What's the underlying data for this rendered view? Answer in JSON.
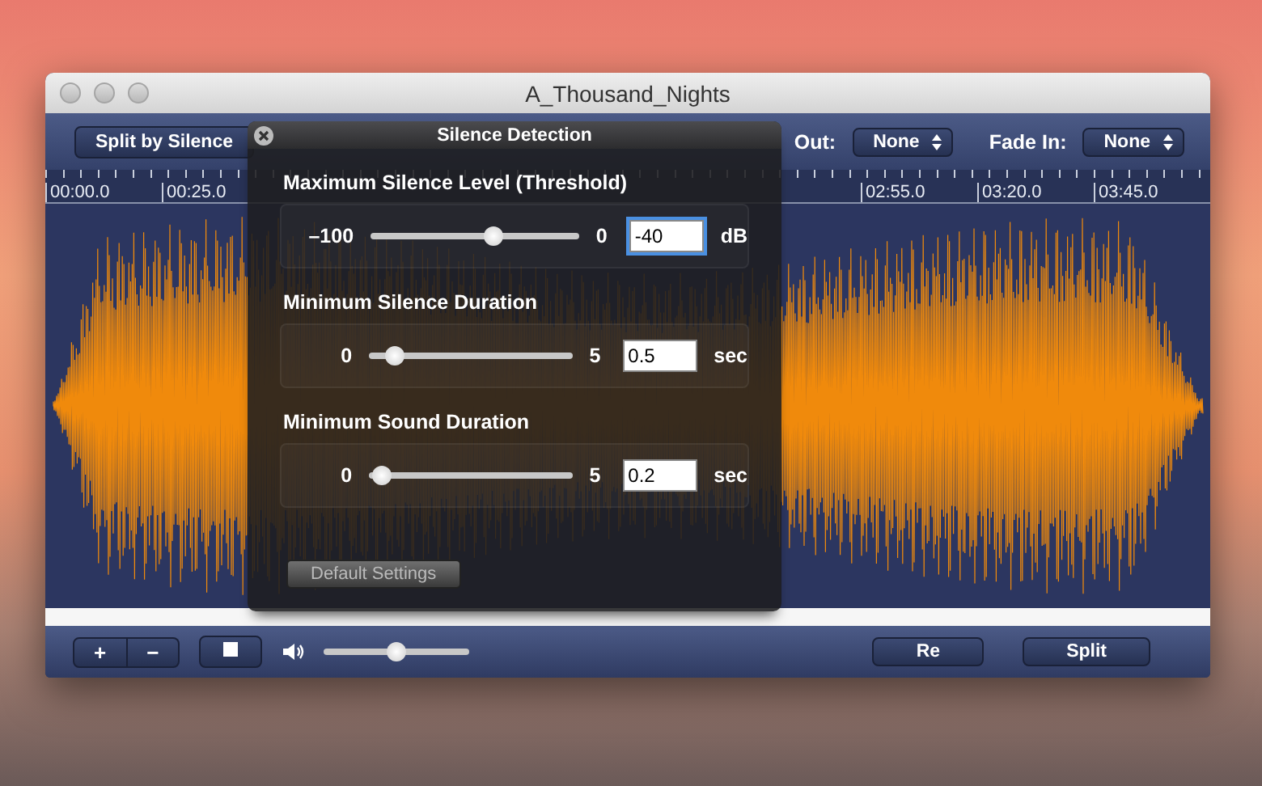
{
  "window": {
    "title": "A_Thousand_Nights"
  },
  "toolbar": {
    "split_button": "Split by Silence",
    "fade_out": {
      "label": "Out:",
      "value": "None"
    },
    "fade_in": {
      "label": "Fade In:",
      "value": "None"
    }
  },
  "ruler": {
    "labels": [
      "00:00.0",
      "00:25.0",
      "02:55.0",
      "03:20.0",
      "03:45.0"
    ]
  },
  "dialog": {
    "title": "Silence Detection",
    "sections": [
      {
        "title": "Maximum Silence Level (Threshold)",
        "min": "–100",
        "max": "0",
        "level": 0.59,
        "value": "-40",
        "unit": "dB",
        "focused": true
      },
      {
        "title": "Minimum Silence Duration",
        "min": "0",
        "max": "5",
        "level": 0.13,
        "value": "0.5",
        "unit": "sec",
        "focused": false
      },
      {
        "title": "Minimum Sound Duration",
        "min": "0",
        "max": "5",
        "level": 0.07,
        "value": "0.2",
        "unit": "sec",
        "focused": false
      }
    ],
    "default_button": "Default Settings"
  },
  "bottom_bar": {
    "zoom_in": "+",
    "zoom_out": "−",
    "volume": {
      "level": 0.5
    },
    "buttons": [
      "Re",
      "Split"
    ]
  }
}
